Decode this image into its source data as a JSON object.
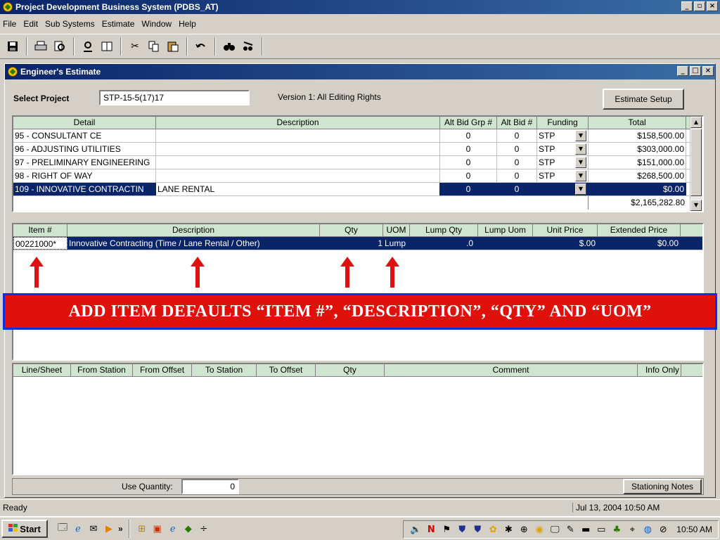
{
  "window": {
    "title": "Project Development Business System (PDBS_AT)",
    "min": "_",
    "max": "▫",
    "close": "×"
  },
  "menu": [
    "File",
    "Edit",
    "Sub Systems",
    "Estimate",
    "Window",
    "Help"
  ],
  "toolbar_icons": [
    "save-icon",
    "print-icon",
    "print-preview-icon",
    "tools-icon",
    "window-icon",
    "cut-icon",
    "copy-icon",
    "paste-icon",
    "undo-icon",
    "find-icon",
    "find-replace-icon"
  ],
  "child": {
    "title": "Engineer's Estimate",
    "select_project_label": "Select Project",
    "project_value": "STP-15-5(17)17",
    "version_text": "Version 1: All Editing Rights",
    "estimate_setup": "Estimate Setup"
  },
  "upper_grid": {
    "headers": [
      "Detail",
      "Description",
      "Alt Bid Grp #",
      "Alt Bid #",
      "Funding",
      "Total"
    ],
    "rows": [
      {
        "detail": "95 - CONSULTANT CE",
        "description": "",
        "alt_grp": "0",
        "alt_bid": "0",
        "funding": "STP",
        "total": "$158,500.00"
      },
      {
        "detail": "96 - ADJUSTING UTILITIES",
        "description": "",
        "alt_grp": "0",
        "alt_bid": "0",
        "funding": "STP",
        "total": "$303,000.00"
      },
      {
        "detail": "97 - PRELIMINARY ENGINEERING",
        "description": "",
        "alt_grp": "0",
        "alt_bid": "0",
        "funding": "STP",
        "total": "$151,000.00"
      },
      {
        "detail": "98 - RIGHT OF WAY",
        "description": "",
        "alt_grp": "0",
        "alt_bid": "0",
        "funding": "STP",
        "total": "$268,500.00"
      },
      {
        "detail": "109 - INNOVATIVE CONTRACTIN",
        "description": "LANE RENTAL",
        "alt_grp": "0",
        "alt_bid": "0",
        "funding": "",
        "total": "$0.00"
      }
    ],
    "grand_total": "$2,165,282.80"
  },
  "items_grid": {
    "headers": [
      "Item #",
      "Description",
      "Qty",
      "UOM",
      "Lump Qty",
      "Lump Uom",
      "Unit Price",
      "Extended Price"
    ],
    "rows": [
      {
        "item": "00221000*",
        "description": "Innovative Contracting (Time / Lane Rental / Other)",
        "qty": "1",
        "uom": "Lump",
        "lump_qty": ".0",
        "lump_uom": "",
        "unit_price": "$.00",
        "ext_price": "$0.00"
      }
    ]
  },
  "banner": "ADD  ITEM DEFAULTS “ITEM #”, “DESCRIPTION”, “QTY” AND “UOM”",
  "station_grid": {
    "headers": [
      "Line/Sheet",
      "From Station",
      "From Offset",
      "To Station",
      "To Offset",
      "Qty",
      "Comment",
      "Info Only"
    ]
  },
  "bottom": {
    "use_quantity_label": "Use Quantity:",
    "use_quantity_value": "0",
    "stationing_notes": "Stationing Notes"
  },
  "status": {
    "text": "Ready",
    "datetime": "Jul 13, 2004 10:50 AM"
  },
  "taskbar": {
    "start": "Start",
    "chevron": "»",
    "clock": "10:50 AM"
  },
  "colors": {
    "title_start": "#0a246a",
    "title_end": "#3a6ea5",
    "header_green": "#cfe5cf",
    "banner_red": "#e0100a",
    "banner_border": "#1030e0"
  }
}
